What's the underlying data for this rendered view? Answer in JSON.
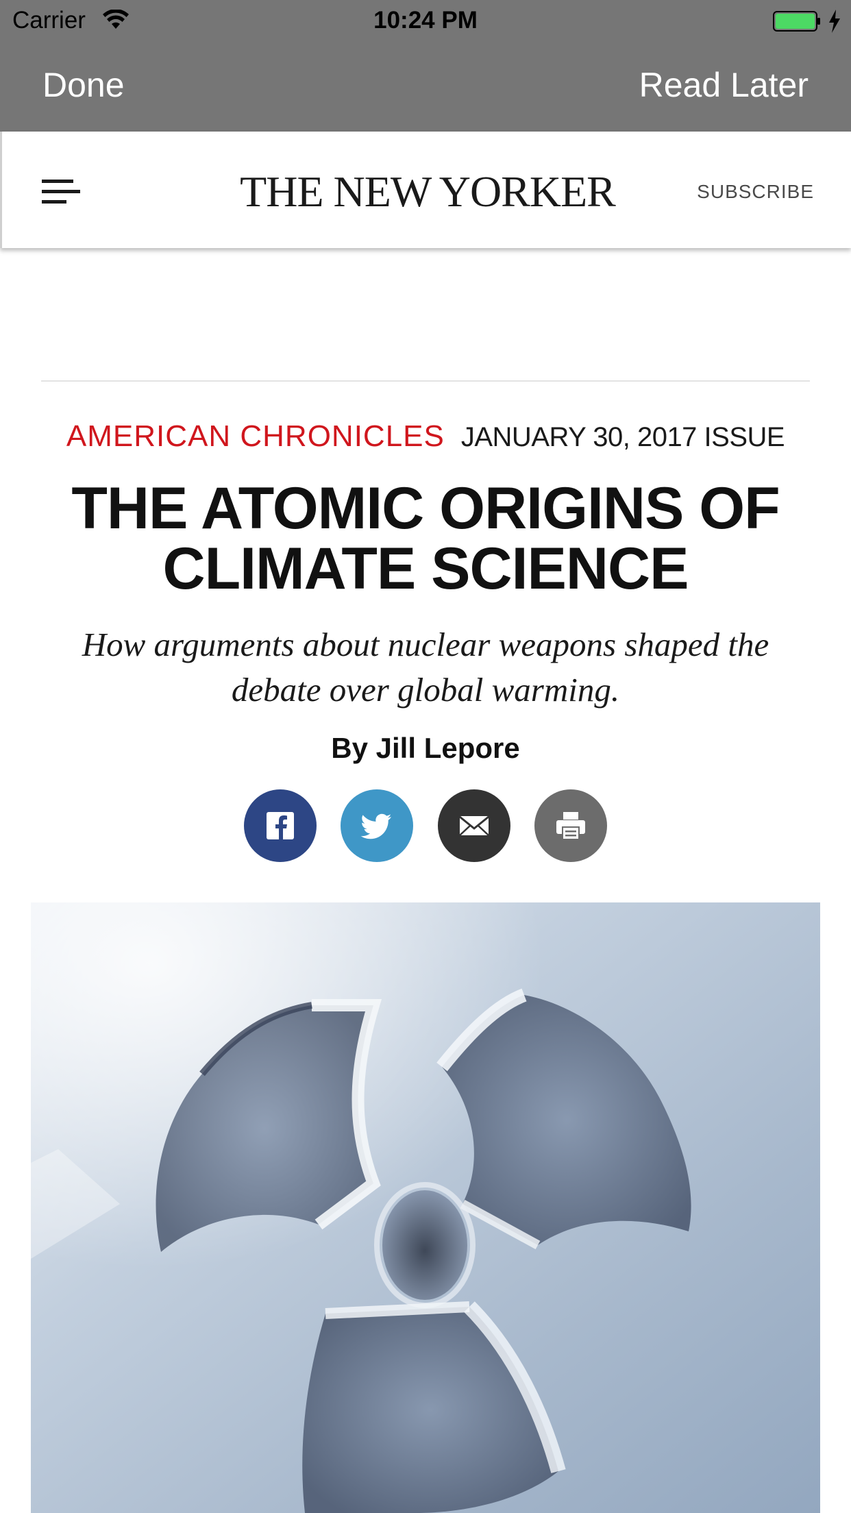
{
  "status_bar": {
    "carrier": "Carrier",
    "time": "10:24 PM",
    "icons": [
      "wifi-icon",
      "battery-icon",
      "charging-bolt-icon"
    ],
    "battery_color": "#4cd964"
  },
  "nav_bar": {
    "done_label": "Done",
    "read_later_label": "Read Later",
    "background": "#767676"
  },
  "site_header": {
    "logo_text": "THE NEW YORKER",
    "subscribe_label": "SUBSCRIBE",
    "menu_icon": "hamburger-icon"
  },
  "article": {
    "rubric": "AMERICAN CHRONICLES",
    "rubric_color": "#d0161d",
    "issue": "JANUARY 30, 2017 ISSUE",
    "headline": "THE ATOMIC ORIGINS OF CLIMATE SCIENCE",
    "dek": "How arguments about nuclear weapons shaped the debate over global warming.",
    "byline_prefix": "By",
    "author": "Jill Lepore"
  },
  "share_buttons": [
    {
      "name": "facebook",
      "icon": "facebook-icon",
      "color": "#2d4685"
    },
    {
      "name": "twitter",
      "icon": "twitter-icon",
      "color": "#3f97c7"
    },
    {
      "name": "email",
      "icon": "email-icon",
      "color": "#333333"
    },
    {
      "name": "print",
      "icon": "print-icon",
      "color": "#6c6c6c"
    }
  ],
  "hero_image": {
    "subject": "radiation-symbol-in-snow"
  }
}
